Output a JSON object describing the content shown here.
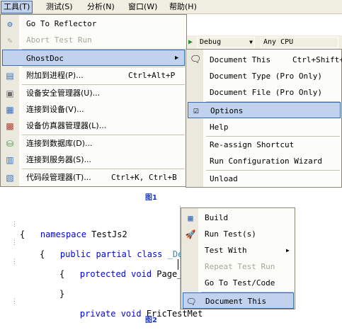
{
  "menubar": {
    "items": [
      {
        "label": "工具(T)"
      },
      {
        "label": "测试(S)"
      },
      {
        "label": "分析(N)"
      },
      {
        "label": "窗口(W)"
      },
      {
        "label": "帮助(H)"
      }
    ]
  },
  "toolbar": {
    "config": "Debug",
    "platform": "Any CPU"
  },
  "tools_menu": {
    "items": [
      {
        "label": "Go To Reflector",
        "shortcut": ""
      },
      {
        "label": "Abort Test Run",
        "shortcut": ""
      },
      {
        "label": "GhostDoc",
        "shortcut": ""
      },
      {
        "label": "附加到进程(P)...",
        "shortcut": "Ctrl+Alt+P"
      },
      {
        "label": "设备安全管理器(U)...",
        "shortcut": ""
      },
      {
        "label": "连接到设备(V)...",
        "shortcut": ""
      },
      {
        "label": "设备仿真器管理器(L)...",
        "shortcut": ""
      },
      {
        "label": "连接到数据库(D)...",
        "shortcut": ""
      },
      {
        "label": "连接到服务器(S)...",
        "shortcut": ""
      },
      {
        "label": "代码段管理器(T)...",
        "shortcut": "Ctrl+K, Ctrl+B"
      }
    ]
  },
  "ghostdoc_menu": {
    "items": [
      {
        "label": "Document This",
        "shortcut": "Ctrl+Shift+D"
      },
      {
        "label": "Document Type (Pro Only)",
        "shortcut": ""
      },
      {
        "label": "Document File (Pro Only)",
        "shortcut": ""
      },
      {
        "label": "Options",
        "shortcut": ""
      },
      {
        "label": "Help",
        "shortcut": ""
      },
      {
        "label": "Re-assign Shortcut",
        "shortcut": ""
      },
      {
        "label": "Run Configuration Wizard",
        "shortcut": ""
      },
      {
        "label": "Unload",
        "shortcut": ""
      }
    ]
  },
  "captions": {
    "fig1": "图1",
    "fig2": "图2"
  },
  "code": {
    "namespace_kw": "namespace",
    "namespace_name": " TestJs2",
    "open_brace": "{",
    "close_brace": "}",
    "class_line_kw": "public partial class",
    "class_name": " _Default",
    "method1_kw": "protected void",
    "method1_name": " Page_Load",
    "method2_kw": "private void",
    "method2_name": " EricTestMet"
  },
  "context_menu": {
    "items": [
      {
        "label": "Build"
      },
      {
        "label": "Run Test(s)"
      },
      {
        "label": "Test With"
      },
      {
        "label": "Repeat Test Run"
      },
      {
        "label": "Go To Test/Code"
      },
      {
        "label": "Document This"
      }
    ]
  }
}
